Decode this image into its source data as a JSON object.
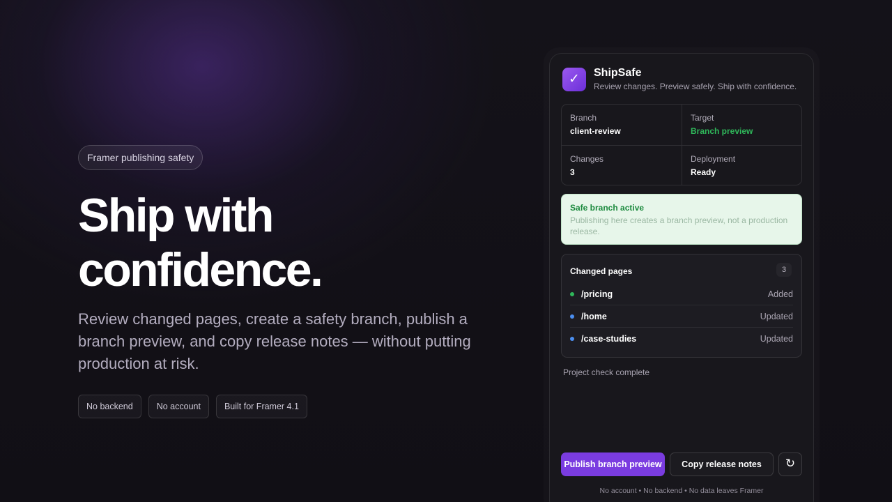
{
  "hero": {
    "pill": "Framer publishing safety",
    "headline_line1": "Ship with",
    "headline_line2": "confidence.",
    "subtext": "Review changed pages, create a safety branch, publish a branch preview, and copy release notes — without putting production at risk.",
    "tags": [
      "No backend",
      "No account",
      "Built for Framer 4.1"
    ]
  },
  "app": {
    "icon": "check-mark-icon",
    "icon_glyph": "✓",
    "title": "ShipSafe",
    "subtitle": "Review changes. Preview safely. Ship with confidence."
  },
  "summary": {
    "branch_label": "Branch",
    "branch_value": "client-review",
    "target_label": "Target",
    "target_value": "Branch preview",
    "changes_label": "Changes",
    "changes_value": "3",
    "deployment_label": "Deployment",
    "deployment_value": "Ready"
  },
  "notice": {
    "title": "Safe branch active",
    "body": "Publishing here creates a branch preview, not a production release."
  },
  "changed_pages": {
    "title": "Changed pages",
    "count": "3",
    "rows": [
      {
        "path": "/pricing",
        "status": "Added",
        "dot_color": "#2fb75a"
      },
      {
        "path": "/home",
        "status": "Updated",
        "dot_color": "#4b8ef0"
      },
      {
        "path": "/case-studies",
        "status": "Updated",
        "dot_color": "#4b8ef0"
      }
    ]
  },
  "check_status": "Project check complete",
  "actions": {
    "publish": "Publish branch preview",
    "copy": "Copy release notes",
    "refresh_icon": "refresh-icon",
    "refresh_glyph": "↻"
  },
  "footnote": "No account • No backend • No data leaves Framer",
  "colors": {
    "accent": "#7a3ce0",
    "success": "#2fb75a",
    "info": "#4b8ef0"
  }
}
